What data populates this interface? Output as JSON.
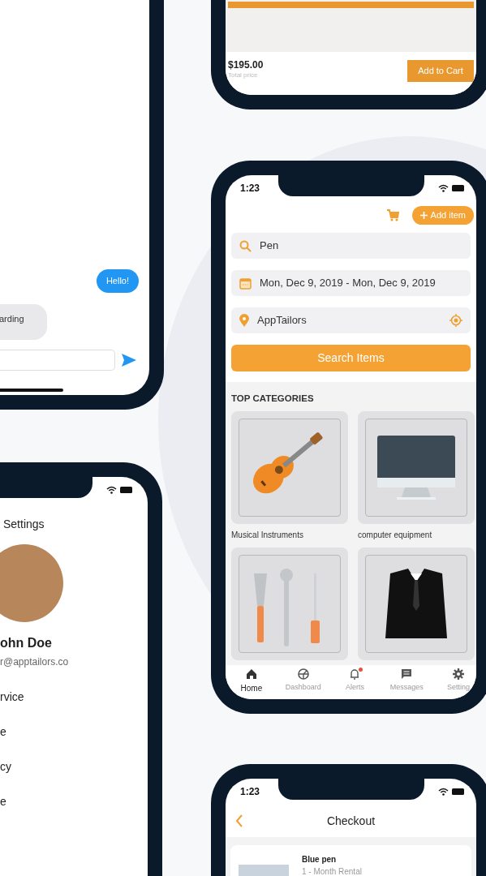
{
  "chat_screen": {
    "messages": [
      {
        "text": "Hello!",
        "sent": true
      },
      {
        "text": "arding",
        "sent": false
      }
    ]
  },
  "product_screen": {
    "price": "$195.00",
    "price_label": "Total price",
    "add_button": "Add to Cart"
  },
  "search_screen": {
    "time": "1:23",
    "add_button": "Add item",
    "search_value": "Pen",
    "dates": "Mon, Dec 9, 2019 - Mon, Dec 9, 2019",
    "location": "AppTailors",
    "search_button": "Search Items",
    "categories_title": "TOP CATEGORIES",
    "categories": [
      {
        "name": "Musical Instruments",
        "kind": "guitar"
      },
      {
        "name": "computer equipment",
        "kind": "monitor"
      },
      {
        "kind": "tools"
      },
      {
        "kind": "suit"
      }
    ],
    "tabs": [
      {
        "label": "Home",
        "kind": "home",
        "selected": true,
        "alert": false
      },
      {
        "label": "Dashboard",
        "kind": "dashboard",
        "selected": false,
        "alert": false
      },
      {
        "label": "Alerts",
        "kind": "bell",
        "selected": false,
        "alert": true
      },
      {
        "label": "Messages",
        "kind": "message",
        "selected": false,
        "alert": false
      },
      {
        "label": "Setting",
        "kind": "gear",
        "selected": false,
        "alert": false
      }
    ]
  },
  "settings_screen": {
    "title": "Settings",
    "name": "ohn Doe",
    "email": "r@apptailors.co",
    "menu": [
      "rvice",
      "e",
      "cy",
      "e"
    ]
  },
  "checkout_screen": {
    "time": "1:23",
    "title": "Checkout",
    "item": {
      "name": "Blue pen",
      "detail": "1 - Month Rental"
    }
  }
}
